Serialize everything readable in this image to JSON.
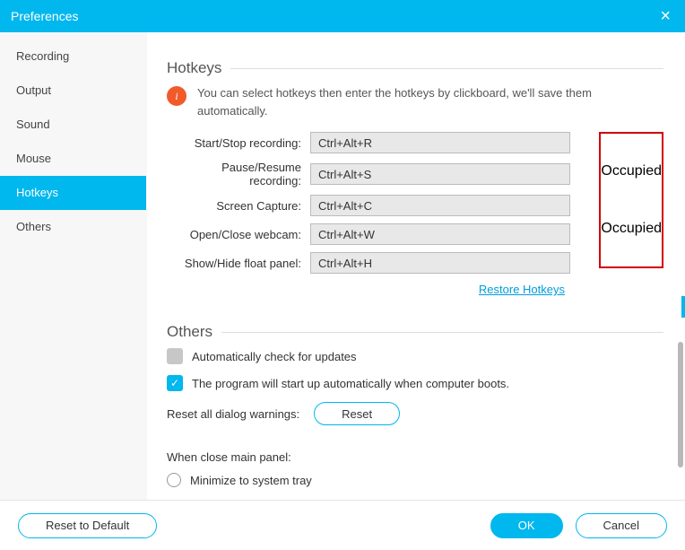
{
  "window": {
    "title": "Preferences"
  },
  "sidebar": {
    "items": [
      {
        "label": "Recording",
        "selected": false
      },
      {
        "label": "Output",
        "selected": false
      },
      {
        "label": "Sound",
        "selected": false
      },
      {
        "label": "Mouse",
        "selected": false
      },
      {
        "label": "Hotkeys",
        "selected": true
      },
      {
        "label": "Others",
        "selected": false
      }
    ]
  },
  "hotkeys": {
    "section_title": "Hotkeys",
    "info_text": "You can select hotkeys then enter the hotkeys by clickboard, we'll save them automatically.",
    "rows": [
      {
        "label": "Start/Stop recording:",
        "value": "Ctrl+Alt+R",
        "status": ""
      },
      {
        "label": "Pause/Resume recording:",
        "value": "Ctrl+Alt+S",
        "status": "Occupied"
      },
      {
        "label": "Screen Capture:",
        "value": "Ctrl+Alt+C",
        "status": ""
      },
      {
        "label": "Open/Close webcam:",
        "value": "Ctrl+Alt+W",
        "status": "Occupied"
      },
      {
        "label": "Show/Hide float panel:",
        "value": "Ctrl+Alt+H",
        "status": ""
      }
    ],
    "restore_label": "Restore Hotkeys"
  },
  "others": {
    "section_title": "Others",
    "auto_update": {
      "label": "Automatically check for updates",
      "checked": false
    },
    "autostart": {
      "label": "The program will start up automatically when computer boots.",
      "checked": true
    },
    "reset_warnings": {
      "label": "Reset all dialog warnings:",
      "button": "Reset"
    },
    "close_panel": {
      "label": "When close main panel:",
      "option1": "Minimize to system tray"
    }
  },
  "footer": {
    "reset_default": "Reset to Default",
    "ok": "OK",
    "cancel": "Cancel"
  }
}
